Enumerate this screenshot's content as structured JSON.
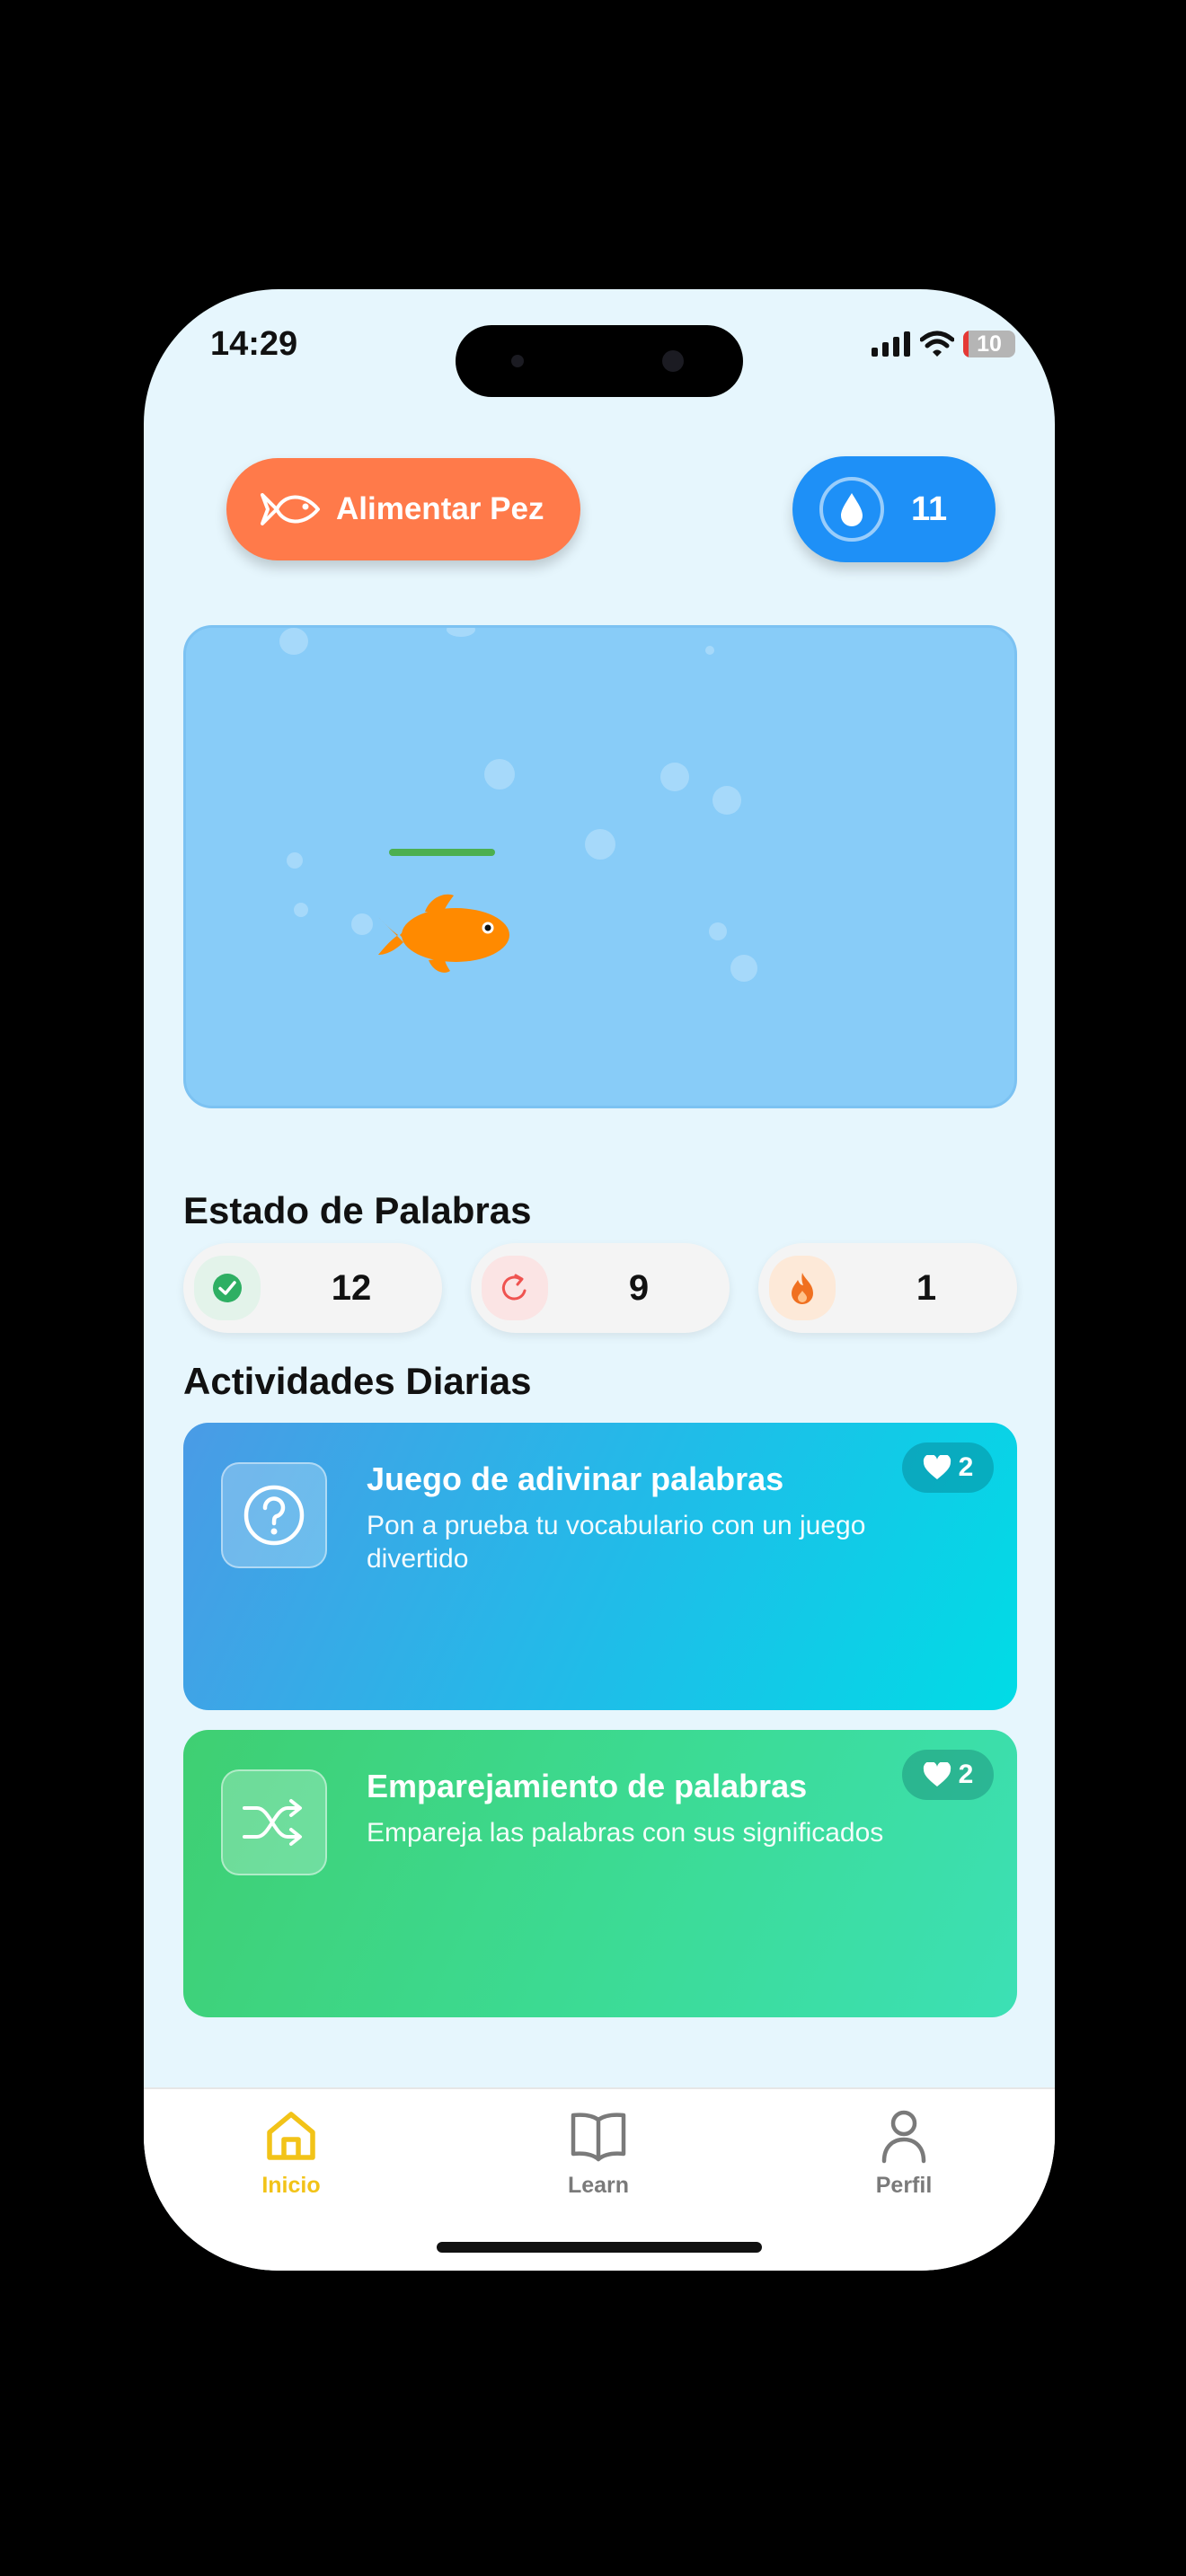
{
  "status_bar": {
    "time": "14:29",
    "battery_level": "10",
    "battery_color": "#e53935"
  },
  "header": {
    "feed_button": {
      "label": "Alimentar Pez",
      "icon": "fish-outline-icon",
      "color": "#ff7a4a"
    },
    "drops_counter": {
      "value": "11",
      "icon": "water-drop-icon",
      "color": "#1e90f7"
    }
  },
  "aquarium": {
    "background": "#88ccf8",
    "fish_color": "#ff8a00",
    "food_bar_color": "#4caf50"
  },
  "word_status": {
    "heading": "Estado de Palabras",
    "items": [
      {
        "icon": "check-circle-icon",
        "value": "12",
        "color": "#2eaf63"
      },
      {
        "icon": "refresh-icon",
        "value": "9",
        "color": "#ef5350"
      },
      {
        "icon": "flame-icon",
        "value": "1",
        "color": "#f07020"
      }
    ]
  },
  "daily_activities": {
    "heading": "Actividades Diarias",
    "cards": [
      {
        "title": "Juego de adivinar palabras",
        "description": "Pon a prueba tu vocabulario con un juego divertido",
        "hearts": "2",
        "icon": "question-circle-icon"
      },
      {
        "title": "Emparejamiento de palabras",
        "description": "Empareja las palabras con sus significados",
        "hearts": "2",
        "icon": "shuffle-icon"
      }
    ]
  },
  "tab_bar": {
    "tabs": [
      {
        "label": "Inicio",
        "icon": "home-icon",
        "active": true,
        "color": "#f2c318"
      },
      {
        "label": "Learn",
        "icon": "book-icon",
        "active": false,
        "color": "#7a7a7a"
      },
      {
        "label": "Perfil",
        "icon": "person-icon",
        "active": false,
        "color": "#7a7a7a"
      }
    ]
  }
}
